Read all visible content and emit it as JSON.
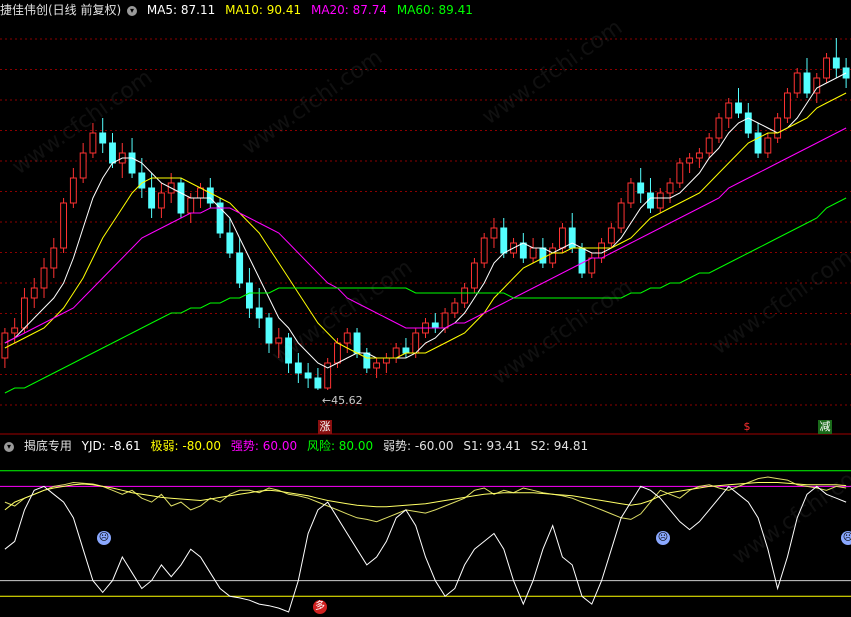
{
  "header": {
    "title": "捷佳伟创(日线 前复权)",
    "ma5": "MA5: 87.11",
    "ma10": "MA10: 90.41",
    "ma20": "MA20: 87.74",
    "ma60": "MA60: 89.41"
  },
  "indicator": {
    "name": "揭底专用",
    "yjd": "YJD: -8.61",
    "jiruo": "极弱: -80.00",
    "qiangshi": "强势: 60.00",
    "fengxian": "风险: 80.00",
    "ruoshi": "弱势: -60.00",
    "s1": "S1: 93.41",
    "s2": "S2: 94.81"
  },
  "price_low_label": "←45.62",
  "signals": {
    "zhang": "涨",
    "jian": "减",
    "dollar": "$",
    "duo": "多"
  },
  "watermark": "www.cfchi.com",
  "colors": {
    "up": "#ff3232",
    "down": "#54ffff",
    "ma5": "#ffffff",
    "ma10": "#ffff00",
    "ma20": "#ff00ff",
    "ma60": "#00ff00",
    "grid": "#8b0000"
  },
  "chart_data": [
    {
      "type": "candlestick",
      "title": "捷佳伟创(日线 前复权)",
      "ylim": [
        40,
        120
      ],
      "low_annotation": 45.62,
      "ohlc": [
        [
          52,
          58,
          50,
          57
        ],
        [
          57,
          60,
          55,
          58
        ],
        [
          58,
          66,
          57,
          64
        ],
        [
          64,
          68,
          62,
          66
        ],
        [
          66,
          72,
          64,
          70
        ],
        [
          70,
          76,
          68,
          74
        ],
        [
          74,
          84,
          73,
          83
        ],
        [
          83,
          90,
          82,
          88
        ],
        [
          88,
          95,
          87,
          93
        ],
        [
          93,
          99,
          92,
          97
        ],
        [
          97,
          100,
          93,
          95
        ],
        [
          95,
          97,
          90,
          91
        ],
        [
          91,
          95,
          88,
          93
        ],
        [
          93,
          96,
          88,
          89
        ],
        [
          89,
          92,
          84,
          86
        ],
        [
          86,
          89,
          80,
          82
        ],
        [
          82,
          87,
          80,
          85
        ],
        [
          85,
          89,
          83,
          87
        ],
        [
          87,
          88,
          80,
          81
        ],
        [
          81,
          85,
          79,
          84
        ],
        [
          84,
          87,
          82,
          86
        ],
        [
          86,
          88,
          82,
          83
        ],
        [
          83,
          84,
          76,
          77
        ],
        [
          77,
          80,
          72,
          73
        ],
        [
          73,
          76,
          66,
          67
        ],
        [
          67,
          70,
          60,
          62
        ],
        [
          62,
          66,
          58,
          60
        ],
        [
          60,
          61,
          53,
          55
        ],
        [
          55,
          58,
          52,
          56
        ],
        [
          56,
          57,
          49,
          51
        ],
        [
          51,
          53,
          47,
          49
        ],
        [
          49,
          51,
          46,
          48
        ],
        [
          48,
          50,
          45.6,
          46
        ],
        [
          46,
          52,
          45.6,
          51
        ],
        [
          51,
          56,
          50,
          55
        ],
        [
          55,
          58,
          53,
          57
        ],
        [
          57,
          58,
          52,
          53
        ],
        [
          53,
          54,
          49,
          50
        ],
        [
          50,
          52,
          48,
          51
        ],
        [
          51,
          53,
          49,
          52
        ],
        [
          52,
          55,
          51,
          54
        ],
        [
          54,
          56,
          52,
          53
        ],
        [
          53,
          58,
          52,
          57
        ],
        [
          57,
          60,
          56,
          59
        ],
        [
          59,
          61,
          57,
          58
        ],
        [
          58,
          62,
          57,
          61
        ],
        [
          61,
          64,
          60,
          63
        ],
        [
          63,
          67,
          62,
          66
        ],
        [
          66,
          72,
          65,
          71
        ],
        [
          71,
          77,
          70,
          76
        ],
        [
          76,
          80,
          74,
          78
        ],
        [
          78,
          80,
          72,
          73
        ],
        [
          73,
          76,
          72,
          75
        ],
        [
          75,
          77,
          71,
          72
        ],
        [
          72,
          76,
          71,
          74
        ],
        [
          74,
          76,
          70,
          71
        ],
        [
          71,
          75,
          70,
          74
        ],
        [
          74,
          79,
          73,
          78
        ],
        [
          78,
          81,
          73,
          74
        ],
        [
          74,
          75,
          68,
          69
        ],
        [
          69,
          73,
          68,
          72
        ],
        [
          72,
          76,
          71,
          75
        ],
        [
          75,
          79,
          74,
          78
        ],
        [
          78,
          84,
          77,
          83
        ],
        [
          83,
          88,
          82,
          87
        ],
        [
          87,
          90,
          83,
          85
        ],
        [
          85,
          88,
          81,
          82
        ],
        [
          82,
          86,
          81,
          85
        ],
        [
          85,
          88,
          83,
          87
        ],
        [
          87,
          92,
          86,
          91
        ],
        [
          91,
          93,
          89,
          92
        ],
        [
          92,
          94,
          90,
          93
        ],
        [
          93,
          97,
          92,
          96
        ],
        [
          96,
          101,
          95,
          100
        ],
        [
          100,
          104,
          98,
          103
        ],
        [
          103,
          106,
          100,
          101
        ],
        [
          101,
          103,
          96,
          97
        ],
        [
          97,
          99,
          92,
          93
        ],
        [
          93,
          97,
          92,
          96
        ],
        [
          96,
          101,
          95,
          100
        ],
        [
          100,
          106,
          99,
          105
        ],
        [
          105,
          110,
          104,
          109
        ],
        [
          109,
          112,
          104,
          105
        ],
        [
          105,
          109,
          103,
          108
        ],
        [
          108,
          113,
          107,
          112
        ],
        [
          112,
          116,
          108,
          110
        ],
        [
          110,
          112,
          106,
          108
        ]
      ],
      "series": [
        {
          "name": "MA5",
          "values": [
            55,
            56,
            58,
            60,
            62,
            64,
            67,
            72,
            78,
            84,
            88,
            91,
            92,
            92,
            91,
            89,
            87,
            86,
            85,
            84,
            84,
            84,
            82,
            80,
            76,
            72,
            68,
            64,
            60,
            58,
            55,
            53,
            51,
            50,
            51,
            52,
            53,
            53,
            52,
            52,
            52,
            52,
            53,
            55,
            56,
            58,
            59,
            61,
            64,
            67,
            71,
            73,
            74,
            75,
            74,
            74,
            73,
            74,
            75,
            74,
            73,
            73,
            74,
            76,
            79,
            82,
            84,
            84,
            84,
            85,
            87,
            89,
            92,
            94,
            97,
            99,
            100,
            99,
            98,
            97,
            98,
            100,
            103,
            106,
            107,
            108,
            109
          ]
        },
        {
          "name": "MA10",
          "values": [
            54,
            55,
            56,
            57,
            58,
            60,
            62,
            65,
            68,
            72,
            76,
            79,
            82,
            85,
            87,
            88,
            88,
            88,
            88,
            87,
            86,
            85,
            84,
            83,
            81,
            79,
            77,
            74,
            71,
            68,
            65,
            62,
            59,
            57,
            55,
            54,
            53,
            52,
            52,
            52,
            52,
            53,
            53,
            53,
            54,
            55,
            56,
            57,
            59,
            61,
            64,
            66,
            68,
            70,
            71,
            72,
            73,
            73,
            74,
            74,
            74,
            74,
            74,
            75,
            76,
            78,
            80,
            81,
            82,
            83,
            84,
            85,
            87,
            89,
            91,
            93,
            95,
            96,
            97,
            97,
            98,
            99,
            100,
            102,
            103,
            104,
            105
          ]
        },
        {
          "name": "MA20",
          "values": [
            55,
            56,
            57,
            58,
            59,
            60,
            61,
            62,
            64,
            66,
            68,
            70,
            72,
            74,
            76,
            77,
            78,
            79,
            80,
            81,
            81,
            82,
            82,
            82,
            81,
            80,
            79,
            78,
            77,
            75,
            73,
            71,
            69,
            67,
            66,
            64,
            63,
            62,
            61,
            60,
            59,
            58,
            58,
            58,
            58,
            58,
            59,
            59,
            60,
            61,
            62,
            63,
            64,
            65,
            66,
            67,
            68,
            69,
            70,
            71,
            72,
            72,
            73,
            74,
            75,
            76,
            77,
            78,
            79,
            80,
            81,
            82,
            83,
            84,
            86,
            87,
            88,
            89,
            90,
            91,
            92,
            93,
            94,
            95,
            96,
            97,
            98
          ]
        },
        {
          "name": "MA60",
          "values": [
            45,
            46,
            46,
            47,
            48,
            49,
            50,
            51,
            52,
            53,
            54,
            55,
            56,
            57,
            58,
            59,
            60,
            61,
            61,
            62,
            62,
            63,
            63,
            64,
            64,
            65,
            65,
            65,
            66,
            66,
            66,
            66,
            66,
            66,
            66,
            66,
            66,
            66,
            66,
            66,
            66,
            66,
            65,
            65,
            65,
            65,
            65,
            65,
            65,
            65,
            65,
            65,
            64,
            64,
            64,
            64,
            64,
            64,
            64,
            64,
            64,
            64,
            64,
            64,
            65,
            65,
            66,
            66,
            67,
            67,
            68,
            69,
            69,
            70,
            71,
            72,
            73,
            74,
            75,
            76,
            77,
            78,
            79,
            80,
            82,
            83,
            84
          ]
        }
      ]
    },
    {
      "type": "line",
      "title": "揭底专用",
      "ylim": [
        -100,
        100
      ],
      "series": [
        {
          "name": "S1",
          "values": [
            40,
            35,
            45,
            50,
            55,
            60,
            62,
            65,
            64,
            63,
            60,
            55,
            50,
            55,
            45,
            40,
            50,
            35,
            40,
            30,
            35,
            45,
            40,
            50,
            55,
            55,
            52,
            58,
            55,
            50,
            48,
            45,
            40,
            35,
            30,
            25,
            20,
            18,
            15,
            20,
            25,
            30,
            28,
            26,
            30,
            35,
            40,
            45,
            55,
            58,
            50,
            55,
            52,
            58,
            55,
            52,
            50,
            48,
            45,
            40,
            35,
            30,
            25,
            20,
            18,
            25,
            40,
            55,
            50,
            45,
            55,
            60,
            62,
            58,
            55,
            60,
            65,
            70,
            72,
            70,
            68,
            62,
            60,
            58,
            55,
            60,
            58
          ]
        },
        {
          "name": "S2",
          "values": [
            30,
            40,
            45,
            50,
            55,
            58,
            60,
            62,
            63,
            62,
            60,
            58,
            55,
            52,
            50,
            48,
            46,
            45,
            44,
            43,
            42,
            44,
            46,
            48,
            50,
            52,
            54,
            55,
            54,
            52,
            50,
            48,
            45,
            42,
            40,
            38,
            36,
            35,
            34,
            34,
            35,
            36,
            37,
            38,
            40,
            42,
            44,
            46,
            48,
            50,
            51,
            52,
            52,
            52,
            52,
            51,
            50,
            49,
            48,
            46,
            44,
            42,
            40,
            38,
            36,
            38,
            42,
            48,
            52,
            54,
            56,
            58,
            60,
            61,
            62,
            63,
            64,
            65,
            65,
            65,
            64,
            63,
            62,
            62,
            62,
            62,
            61
          ]
        },
        {
          "name": "YJD",
          "values": [
            -20,
            -10,
            30,
            55,
            60,
            50,
            40,
            20,
            -20,
            -60,
            -75,
            -60,
            -30,
            -50,
            -70,
            -60,
            -40,
            -55,
            -40,
            -20,
            -30,
            -50,
            -70,
            -80,
            -82,
            -85,
            -90,
            -92,
            -95,
            -100,
            -60,
            0,
            30,
            40,
            20,
            0,
            -20,
            -40,
            -30,
            -10,
            20,
            30,
            10,
            -30,
            -60,
            -80,
            -70,
            -40,
            -20,
            -10,
            0,
            -20,
            -60,
            -90,
            -60,
            -20,
            10,
            -30,
            -40,
            -80,
            -90,
            -60,
            -20,
            20,
            40,
            60,
            55,
            45,
            30,
            15,
            5,
            15,
            30,
            45,
            60,
            50,
            40,
            20,
            -20,
            -70,
            -30,
            20,
            50,
            60,
            50,
            45,
            40
          ]
        }
      ],
      "hlines": [
        {
          "name": "风险",
          "value": 80
        },
        {
          "name": "强势",
          "value": 60
        },
        {
          "name": "弱势",
          "value": -60
        },
        {
          "name": "极弱",
          "value": -80
        }
      ]
    }
  ]
}
